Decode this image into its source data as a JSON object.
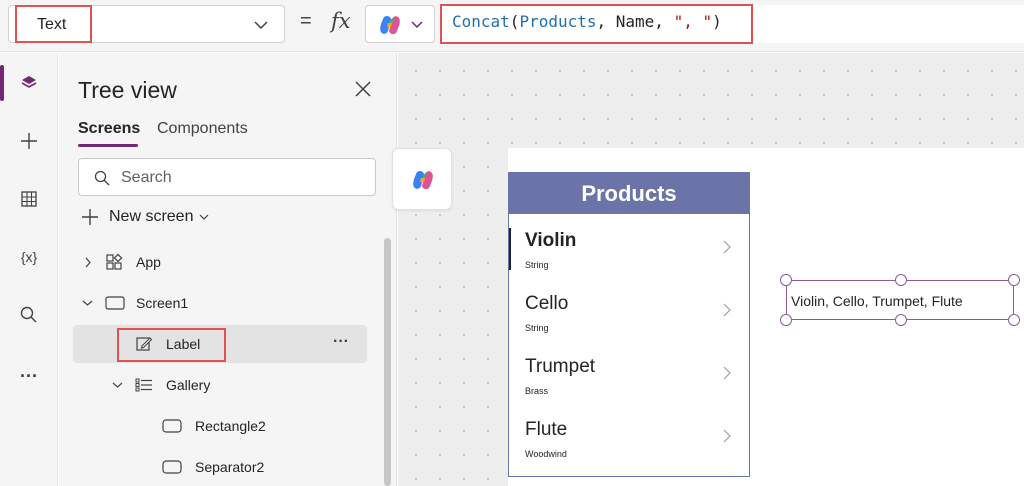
{
  "formula_bar": {
    "property": "Text",
    "equals": "=",
    "fx": "fx",
    "formula": {
      "fn": "Concat",
      "open": "(",
      "arg1": "Products",
      "sep1": ", ",
      "arg2": "Name",
      "sep2": ", ",
      "str": "\", \"",
      "close": ")"
    }
  },
  "rail": {
    "items": [
      {
        "icon": "layers-icon"
      },
      {
        "icon": "plus-icon"
      },
      {
        "icon": "table-icon"
      },
      {
        "icon": "variables-icon",
        "label": "{x}"
      },
      {
        "icon": "search-icon"
      },
      {
        "icon": "more-icon",
        "label": "..."
      }
    ]
  },
  "tree_view": {
    "title": "Tree view",
    "tabs": [
      "Screens",
      "Components"
    ],
    "search_placeholder": "Search",
    "new_screen": "New screen",
    "items": [
      {
        "label": "App"
      },
      {
        "label": "Screen1"
      },
      {
        "label": "Label"
      },
      {
        "label": "Gallery"
      },
      {
        "label": "Rectangle2"
      },
      {
        "label": "Separator2"
      }
    ],
    "more": "···"
  },
  "canvas": {
    "gallery": {
      "header": "Products",
      "items": [
        {
          "name": "Violin",
          "category": "String"
        },
        {
          "name": "Cello",
          "category": "String"
        },
        {
          "name": "Trumpet",
          "category": "Brass"
        },
        {
          "name": "Flute",
          "category": "Woodwind"
        }
      ]
    },
    "label_text": "Violin, Cello, Trumpet, Flute"
  },
  "colors": {
    "accent": "#742774",
    "gallery_header": "#6b74a8",
    "highlight": "#e05252",
    "formula_blue": "#1f6fb3"
  }
}
